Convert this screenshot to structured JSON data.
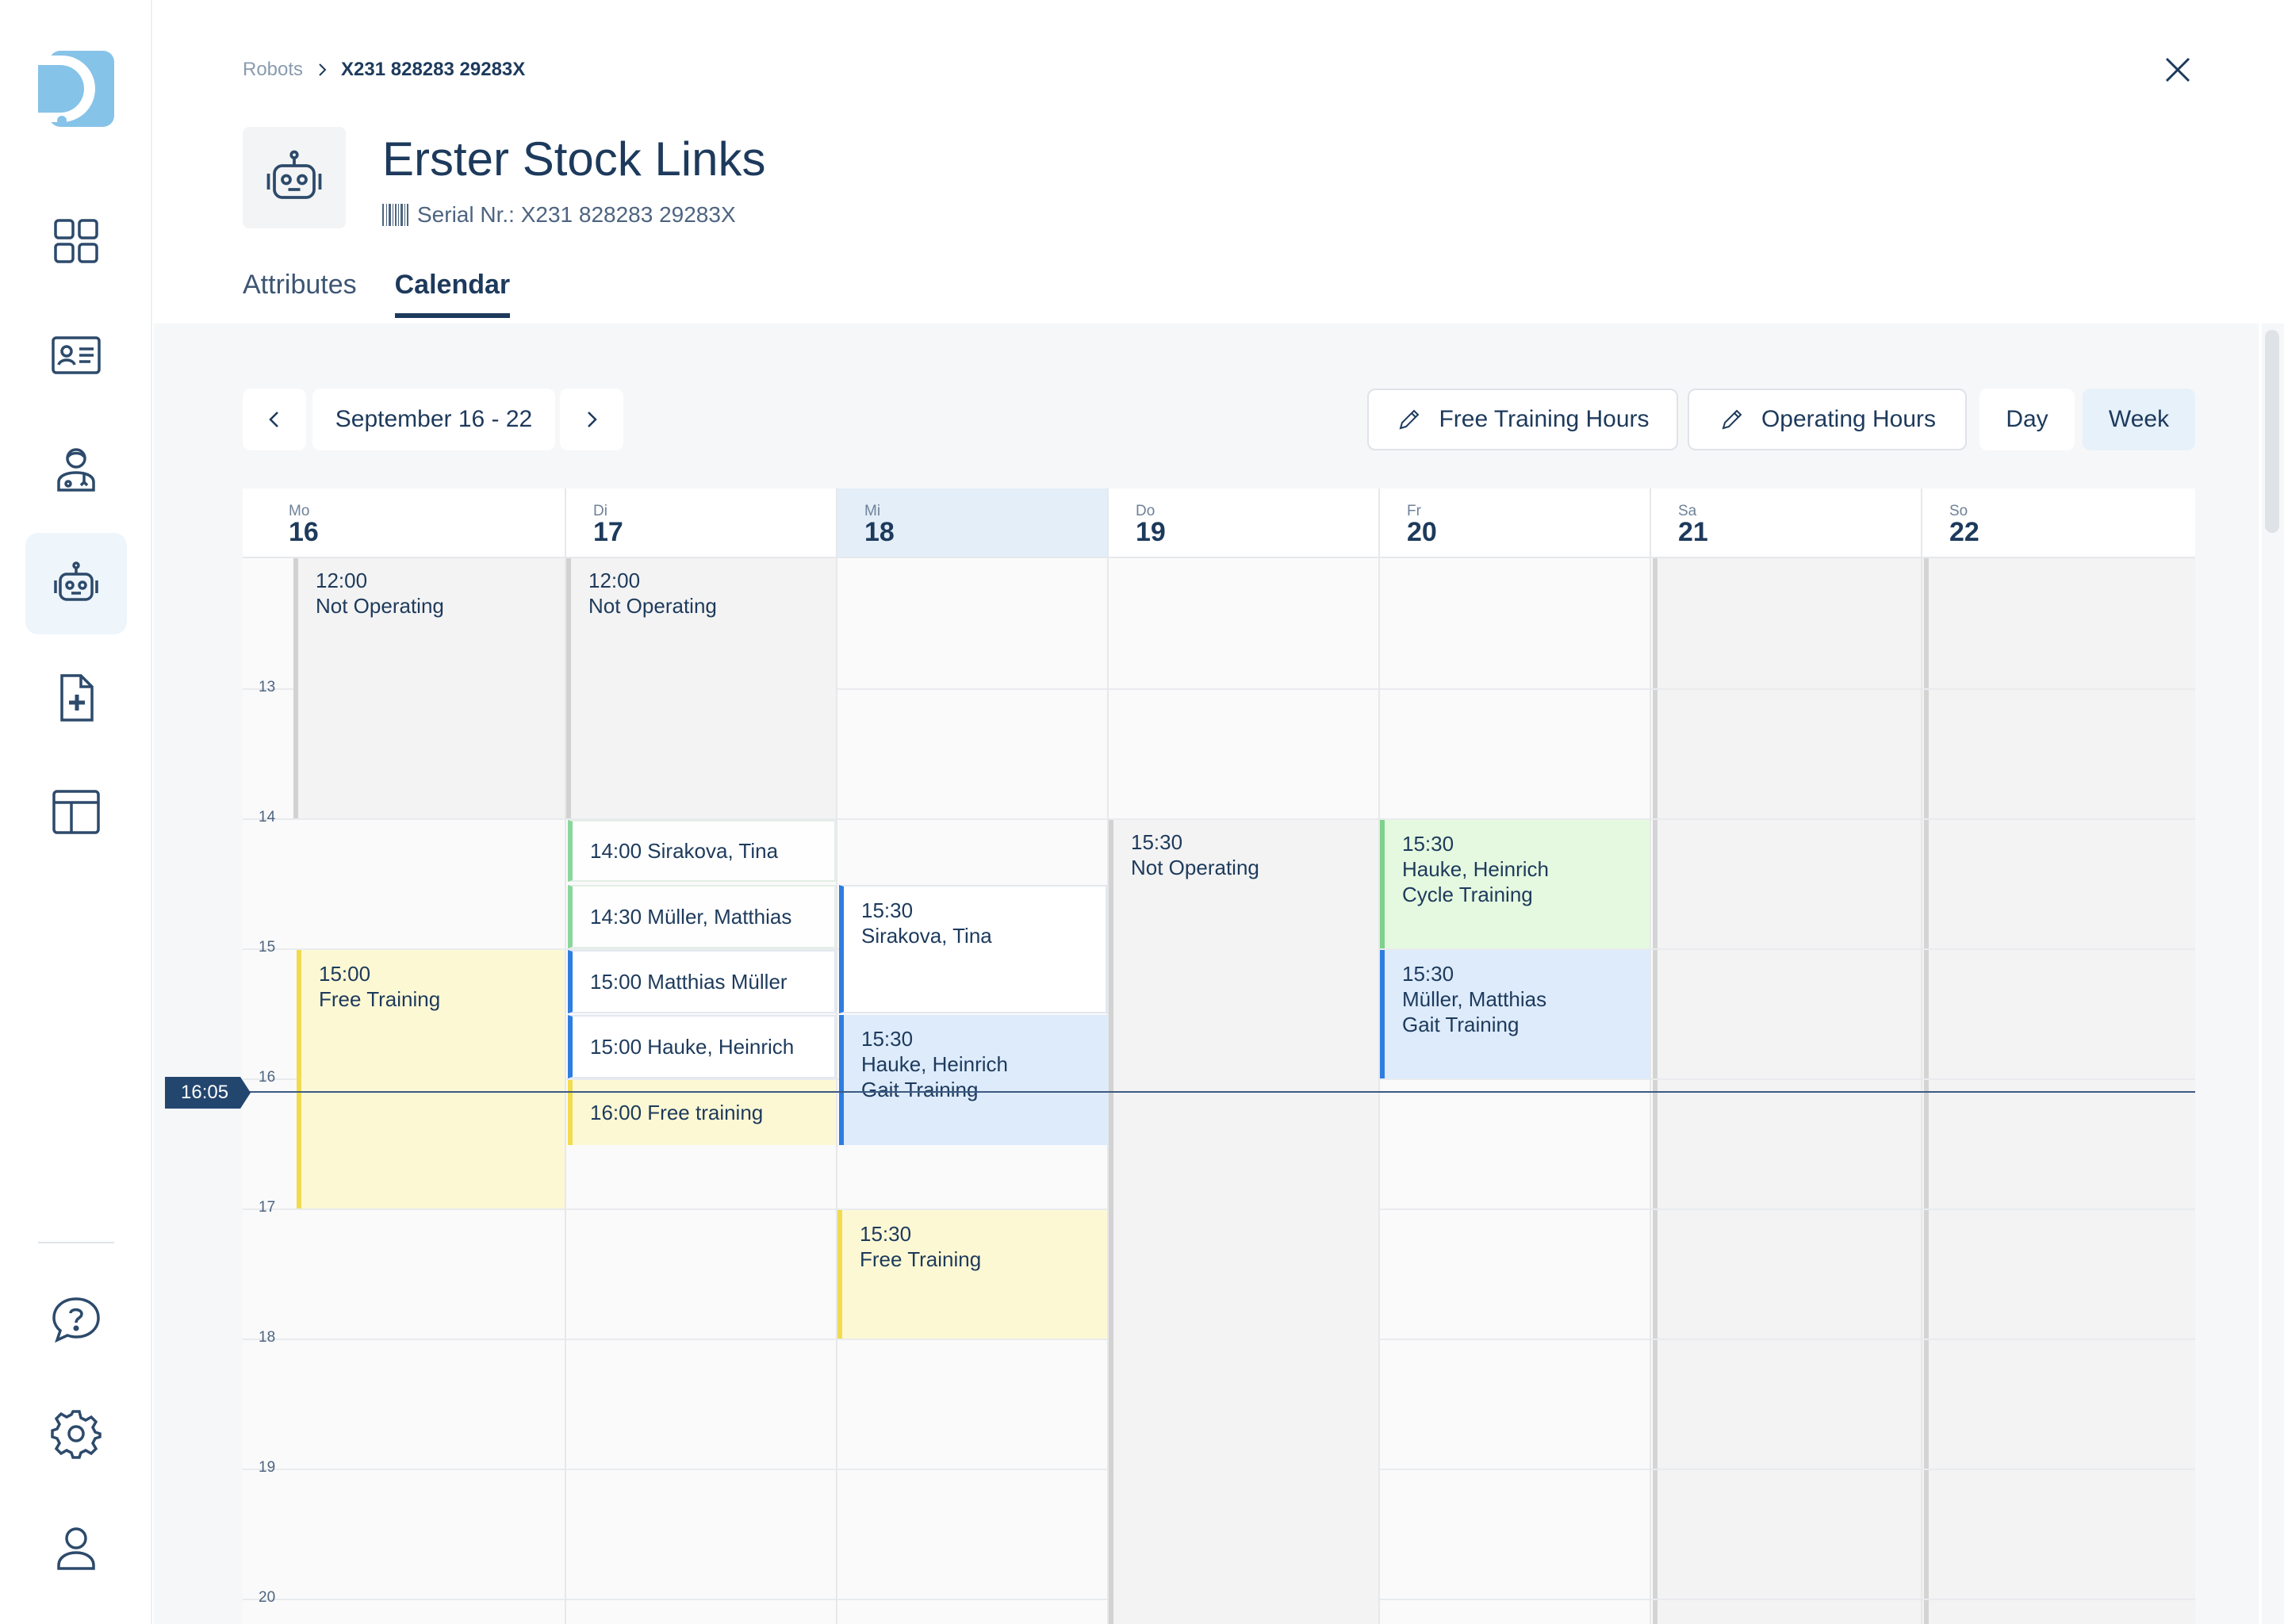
{
  "sidebar": {
    "items": [
      {
        "name": "dashboard",
        "icon": "grid-icon"
      },
      {
        "name": "contacts",
        "icon": "id-card-icon"
      },
      {
        "name": "staff",
        "icon": "doctor-icon"
      },
      {
        "name": "robots",
        "icon": "robot-icon",
        "active": true
      },
      {
        "name": "records",
        "icon": "file-plus-icon"
      },
      {
        "name": "layout",
        "icon": "layout-icon"
      }
    ],
    "bottom_items": [
      {
        "name": "help",
        "icon": "help-icon"
      },
      {
        "name": "settings",
        "icon": "gear-icon"
      },
      {
        "name": "profile",
        "icon": "user-icon"
      }
    ]
  },
  "breadcrumb": {
    "parent": "Robots",
    "current": "X231 828283 29283X"
  },
  "entity": {
    "title": "Erster Stock Links",
    "serial": "Serial Nr.: X231 828283 29283X"
  },
  "tabs": [
    {
      "label": "Attributes",
      "active": false
    },
    {
      "label": "Calendar",
      "active": true
    }
  ],
  "toolbar": {
    "date_range": "September 16 - 22",
    "free_training_label": "Free Training Hours",
    "operating_label": "Operating Hours",
    "day_label": "Day",
    "week_label": "Week",
    "active_view": "Week"
  },
  "calendar": {
    "days": [
      {
        "abbr": "Mo",
        "num": "16"
      },
      {
        "abbr": "Di",
        "num": "17"
      },
      {
        "abbr": "Mi",
        "num": "18",
        "today": true
      },
      {
        "abbr": "Do",
        "num": "19"
      },
      {
        "abbr": "Fr",
        "num": "20"
      },
      {
        "abbr": "Sa",
        "num": "21"
      },
      {
        "abbr": "So",
        "num": "22"
      }
    ],
    "hours": [
      "13",
      "14",
      "15",
      "16",
      "17",
      "18",
      "19",
      "20"
    ],
    "now": "16:05",
    "events": {
      "mo_not_operating": {
        "time": "12:00",
        "title": "Not Operating"
      },
      "mo_free_training": {
        "time": "15:00",
        "title": "Free Training"
      },
      "di_not_operating": {
        "time": "12:00",
        "title": "Not Operating"
      },
      "di_sirakova": "14:00 Sirakova, Tina",
      "di_mueller": "14:30  Müller, Matthias",
      "di_matthias": "15:00 Matthias Müller",
      "di_hauke": "15:00 Hauke, Heinrich",
      "di_free_training": "16:00  Free training",
      "mi_sirakova": {
        "time": "15:30",
        "title": "Sirakova, Tina"
      },
      "mi_hauke": {
        "time": "15:30",
        "title": "Hauke, Heinrich",
        "subtitle": "Gait Training"
      },
      "mi_free_training": {
        "time": "15:30",
        "title": "Free Training"
      },
      "do_not_operating": {
        "time": "15:30",
        "title": "Not Operating"
      },
      "fr_cycle": {
        "time": "15:30",
        "title": "Hauke, Heinrich",
        "subtitle": "Cycle Training"
      },
      "fr_gait": {
        "time": "15:30",
        "title": "Müller, Matthias",
        "subtitle": "Gait Training"
      }
    }
  },
  "colors": {
    "primary": "#1d3a5c",
    "today_header": "#e3eef8",
    "free_training": "#fcf8d4",
    "cycle_training": "#e5f9e0",
    "gait_training": "#ddebfb",
    "not_operating": "#f3f3f3"
  }
}
